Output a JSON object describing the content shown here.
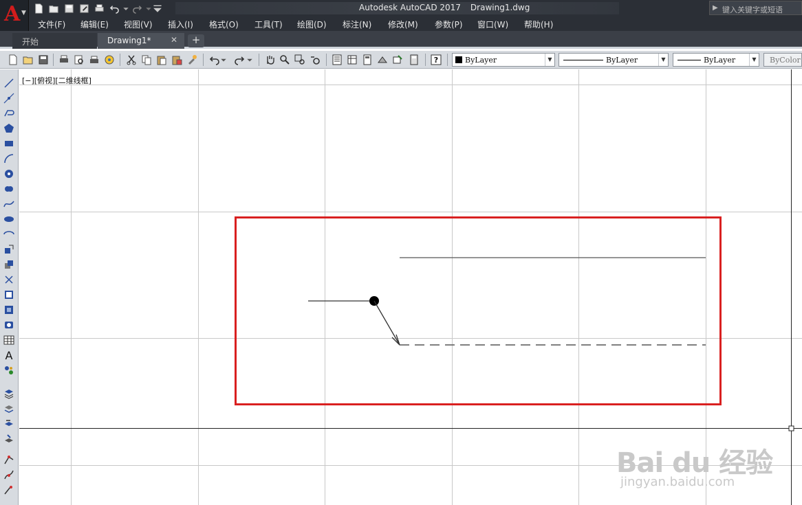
{
  "app": {
    "title": "Autodesk AutoCAD 2017",
    "document": "Drawing1.dwg",
    "search_placeholder": "键入关键字或短语",
    "logo_letter": "A"
  },
  "menu": [
    "文件(F)",
    "编辑(E)",
    "视图(V)",
    "插入(I)",
    "格式(O)",
    "工具(T)",
    "绘图(D)",
    "标注(N)",
    "修改(M)",
    "参数(P)",
    "窗口(W)",
    "帮助(H)"
  ],
  "tabs": {
    "start": "开始",
    "drawing": "Drawing1*",
    "close": "✕",
    "add": "+"
  },
  "properties": {
    "color": "ByLayer",
    "linetype": "ByLayer",
    "lineweight": "ByLayer",
    "plotstyle": "ByColor"
  },
  "viewport": {
    "label": "[−][俯视][二维线框]"
  },
  "watermark": {
    "brand": "Bai du 经验",
    "url": "jingyan.baidu.com"
  },
  "colors": {
    "highlight_box": "#d92020",
    "ribbon_dark": "#2b2f36",
    "toolbar": "#d7dbe0",
    "grid": "#c8c8c8"
  }
}
